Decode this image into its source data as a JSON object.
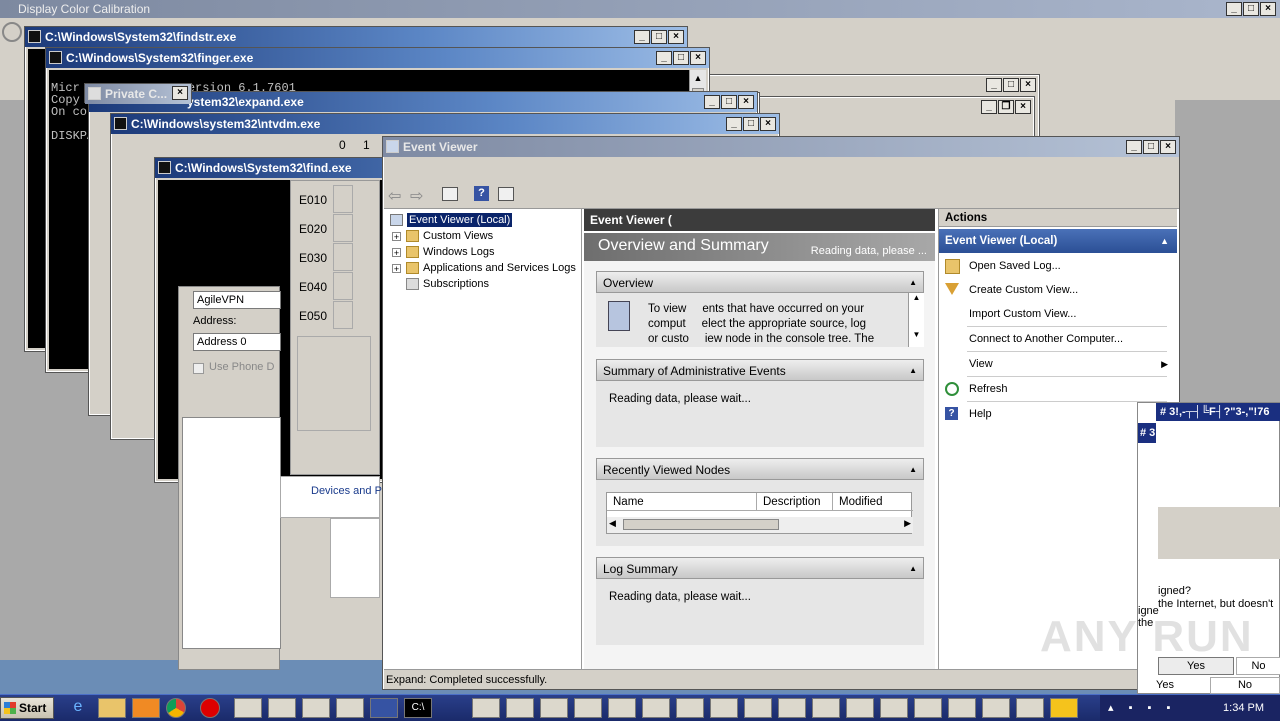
{
  "desktop": {
    "top_window_title": "Display Color Calibration"
  },
  "windows": {
    "findstr": {
      "title": "C:\\Windows\\System32\\findstr.exe"
    },
    "finger": {
      "title": "C:\\Windows\\System32\\finger.exe",
      "console_lines": [
        "Micr              version 6.1.7601",
        "Copy",
        "On co",
        "",
        "DISKPART>"
      ]
    },
    "private": {
      "title": "Private C..."
    },
    "expand": {
      "title": "ystem32\\expand.exe"
    },
    "ntvdm": {
      "title": "C:\\Windows\\system32\\ntvdm.exe",
      "cols": [
        "0",
        "1"
      ],
      "rows": [
        "E010",
        "E020",
        "E030",
        "E040",
        "E050"
      ]
    },
    "find": {
      "title": "C:\\Windows\\System32\\find.exe"
    },
    "vpn": {
      "name_value": "AgileVPN",
      "address_label": "Address:",
      "address_value": "Address 0",
      "checkbox_label": "Use Phone D",
      "devices_label": "Devices and P"
    }
  },
  "event_viewer": {
    "title": "Event Viewer",
    "tree": [
      {
        "label": "Event Viewer (Local)",
        "selected": true,
        "expander": false
      },
      {
        "label": "Custom Views",
        "expander": true
      },
      {
        "label": "Windows Logs",
        "expander": true
      },
      {
        "label": "Applications and Services Logs",
        "expander": true
      },
      {
        "label": "Subscriptions",
        "expander": false
      }
    ],
    "center_header": "Event Viewer (",
    "overview_title": "Overview and Summary",
    "reading_top": "Reading data, please ...",
    "overview_section": "Overview",
    "overview_text": [
      "To view     ents that have occurred on your",
      "comput     elect the appropriate source, log",
      "or custo     iew node in the console tree. The"
    ],
    "summary_section": "Summary of Administrative Events",
    "summary_reading": "Reading data, please wait...",
    "recent_section": "Recently Viewed Nodes",
    "recent_columns": [
      "Name",
      "Description",
      "Modified"
    ],
    "log_section": "Log Summary",
    "log_reading": "Reading data, please wait...",
    "status": "Expand:  Completed successfully.",
    "actions_title": "Actions",
    "actions_group": "Event Viewer (Local)",
    "actions": [
      {
        "label": "Open Saved Log...",
        "icon": "folder-open-icon"
      },
      {
        "label": "Create Custom View...",
        "icon": "filter-icon"
      },
      {
        "label": "Import Custom View...",
        "icon": ""
      },
      {
        "label": "Connect to Another Computer...",
        "icon": ""
      },
      {
        "label": "View",
        "icon": ""
      },
      {
        "label": "Refresh",
        "icon": "refresh-icon"
      },
      {
        "label": "Help",
        "icon": "help-icon"
      }
    ]
  },
  "right_popup": {
    "title": "# 3!,-┬┤╚F┤?\"3-,\"!76",
    "title2": "# 3",
    "text1": "igned?",
    "text2": "the Internet, but doesn't",
    "text3": "igne",
    "text4": "the",
    "yes1": "Yes",
    "no1": "No",
    "yes2": "Yes",
    "no2": "No"
  },
  "watermark": "ANY RUN",
  "taskbar": {
    "start_label": "Start",
    "clock": "1:34 PM"
  }
}
